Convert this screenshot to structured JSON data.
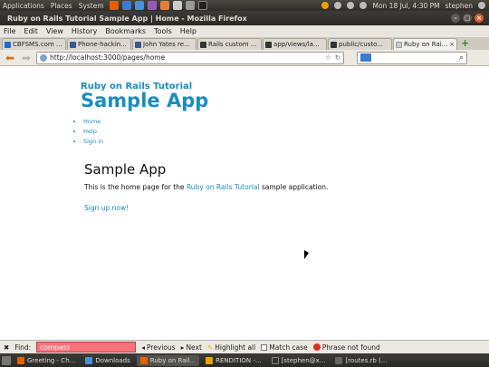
{
  "top_panel": {
    "menus": [
      "Applications",
      "Places",
      "System"
    ],
    "clock": "Mon 18 Jul,  4:30 PM",
    "user": "stephen"
  },
  "window": {
    "title": "Ruby on Rails Tutorial Sample App | Home - Mozilla Firefox"
  },
  "menubar": [
    "File",
    "Edit",
    "View",
    "History",
    "Bookmarks",
    "Tools",
    "Help"
  ],
  "tabs": [
    {
      "label": "CBFSMS.com ...",
      "icon_color": "#1e6bd6"
    },
    {
      "label": "Phone-hackin...",
      "icon_color": "#3b5998"
    },
    {
      "label": "John Yates re...",
      "icon_color": "#3b5998"
    },
    {
      "label": "Rails custom ...",
      "icon_color": "#333333"
    },
    {
      "label": "app/views/la...",
      "icon_color": "#333333"
    },
    {
      "label": "public/custo...",
      "icon_color": "#333333"
    },
    {
      "label": "Ruby on Rai...",
      "icon_color": "#cccccc",
      "active": true
    }
  ],
  "navbar": {
    "url": "http://localhost:3000/pages/home"
  },
  "page": {
    "logo_sub": "Ruby on Rails Tutorial",
    "logo_main": "Sample App",
    "nav": [
      "Home",
      "Help",
      "Sign in"
    ],
    "heading": "Sample App",
    "body_prefix": "This is the home page for the ",
    "body_link": "Ruby on Rails Tutorial",
    "body_suffix": " sample application.",
    "signup": "Sign up now!"
  },
  "findbar": {
    "label": "Find:",
    "query": "compass",
    "previous": "Previous",
    "next": "Next",
    "highlight": "Highlight all",
    "match_case": "Match case",
    "status": "Phrase not found"
  },
  "taskbar": [
    {
      "label": "Greeting - Ch...",
      "icon_color": "#e66000"
    },
    {
      "label": "Downloads",
      "icon_color": "#4a90d9"
    },
    {
      "label": "Ruby on Rail...",
      "icon_color": "#e66000",
      "active": true
    },
    {
      "label": "RENDITION -...",
      "icon_color": "#f0a000"
    },
    {
      "label": "[stephen@x...",
      "icon_color": "#333333"
    },
    {
      "label": "[routes.rb (...",
      "icon_color": "#666666"
    }
  ],
  "colors": {
    "link": "#1b8dbd",
    "find_not_found": "#f87379"
  }
}
